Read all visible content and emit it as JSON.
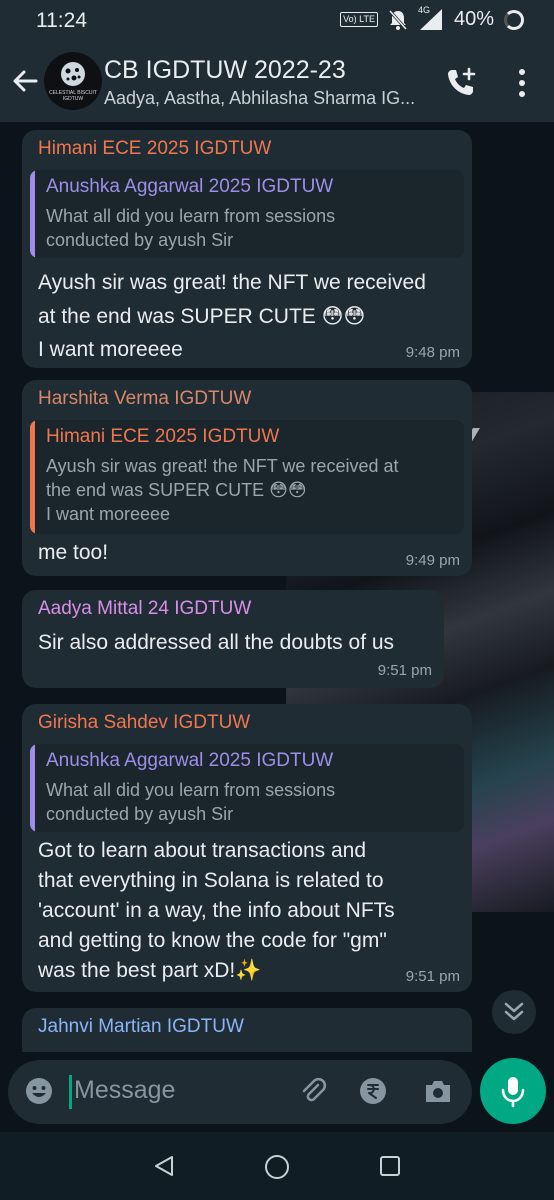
{
  "status_bar": {
    "time": "11:24",
    "volte_label": "Vo) LTE",
    "network": "4G",
    "battery": "40%"
  },
  "header": {
    "title": "CB IGDTUW 2022-23",
    "subtitle": "Aadya, Aastha, Abhilasha Sharma IG...",
    "avatar_text": "CELESTIAL BISCUIT IGDTUW"
  },
  "messages": [
    {
      "sender": "Himani ECE 2025 IGDTUW",
      "sender_color": "#f0764e",
      "quote": {
        "name": "Anushka Aggarwal 2025 IGDTUW",
        "name_color": "#9f8ee8",
        "line1": "What all did you learn from sessions",
        "line2": "conducted by ayush Sir"
      },
      "line1": "Ayush sir was great! the NFT we received",
      "line2": "at the end was SUPER CUTE 😳😳",
      "line3": "I want moreeee",
      "time": "9:48 pm"
    },
    {
      "sender": "Harshita Verma IGDTUW",
      "sender_color": "#d8886a",
      "quote": {
        "name": "Himani ECE 2025 IGDTUW",
        "name_color": "#f0764e",
        "line1": "Ayush sir was great! the NFT we received at",
        "line2": "the end was SUPER CUTE 😳😳",
        "line3": "I want moreeee"
      },
      "line1": "me too!",
      "time": "9:49 pm"
    },
    {
      "sender": "Aadya Mittal 24 IGDTUW",
      "sender_color": "#d98ee8",
      "line1": "Sir also addressed all the doubts of us",
      "time": "9:51 pm"
    },
    {
      "sender": "Girisha Sahdev IGDTUW",
      "sender_color": "#f0764e",
      "quote": {
        "name": "Anushka Aggarwal 2025 IGDTUW",
        "name_color": "#9f8ee8",
        "line1": "What all did you learn from sessions",
        "line2": "conducted by ayush Sir"
      },
      "line1": "Got to learn about transactions and",
      "line2": "that everything in Solana is related to",
      "line3": "'account' in a way, the info about NFTs",
      "line4": "and getting to know the code for \"gm\"",
      "line5": "was the best part xD!✨",
      "time": "9:51 pm"
    },
    {
      "sender": "Jahnvi Martian IGDTUW",
      "sender_color": "#8ab4f8"
    }
  ],
  "wallpaper_text": "Y",
  "composer": {
    "placeholder": "Message"
  },
  "icons": [
    "back-arrow-icon",
    "add-call-icon",
    "more-vert-icon",
    "emoji-icon",
    "attach-icon",
    "rupee-icon",
    "camera-icon",
    "mic-icon",
    "chevron-down-icon",
    "nav-back-icon",
    "nav-home-icon",
    "nav-recent-icon"
  ],
  "colors": {
    "accent": "#00a884",
    "bubble": "#1f2c34",
    "background": "#0b141a"
  }
}
